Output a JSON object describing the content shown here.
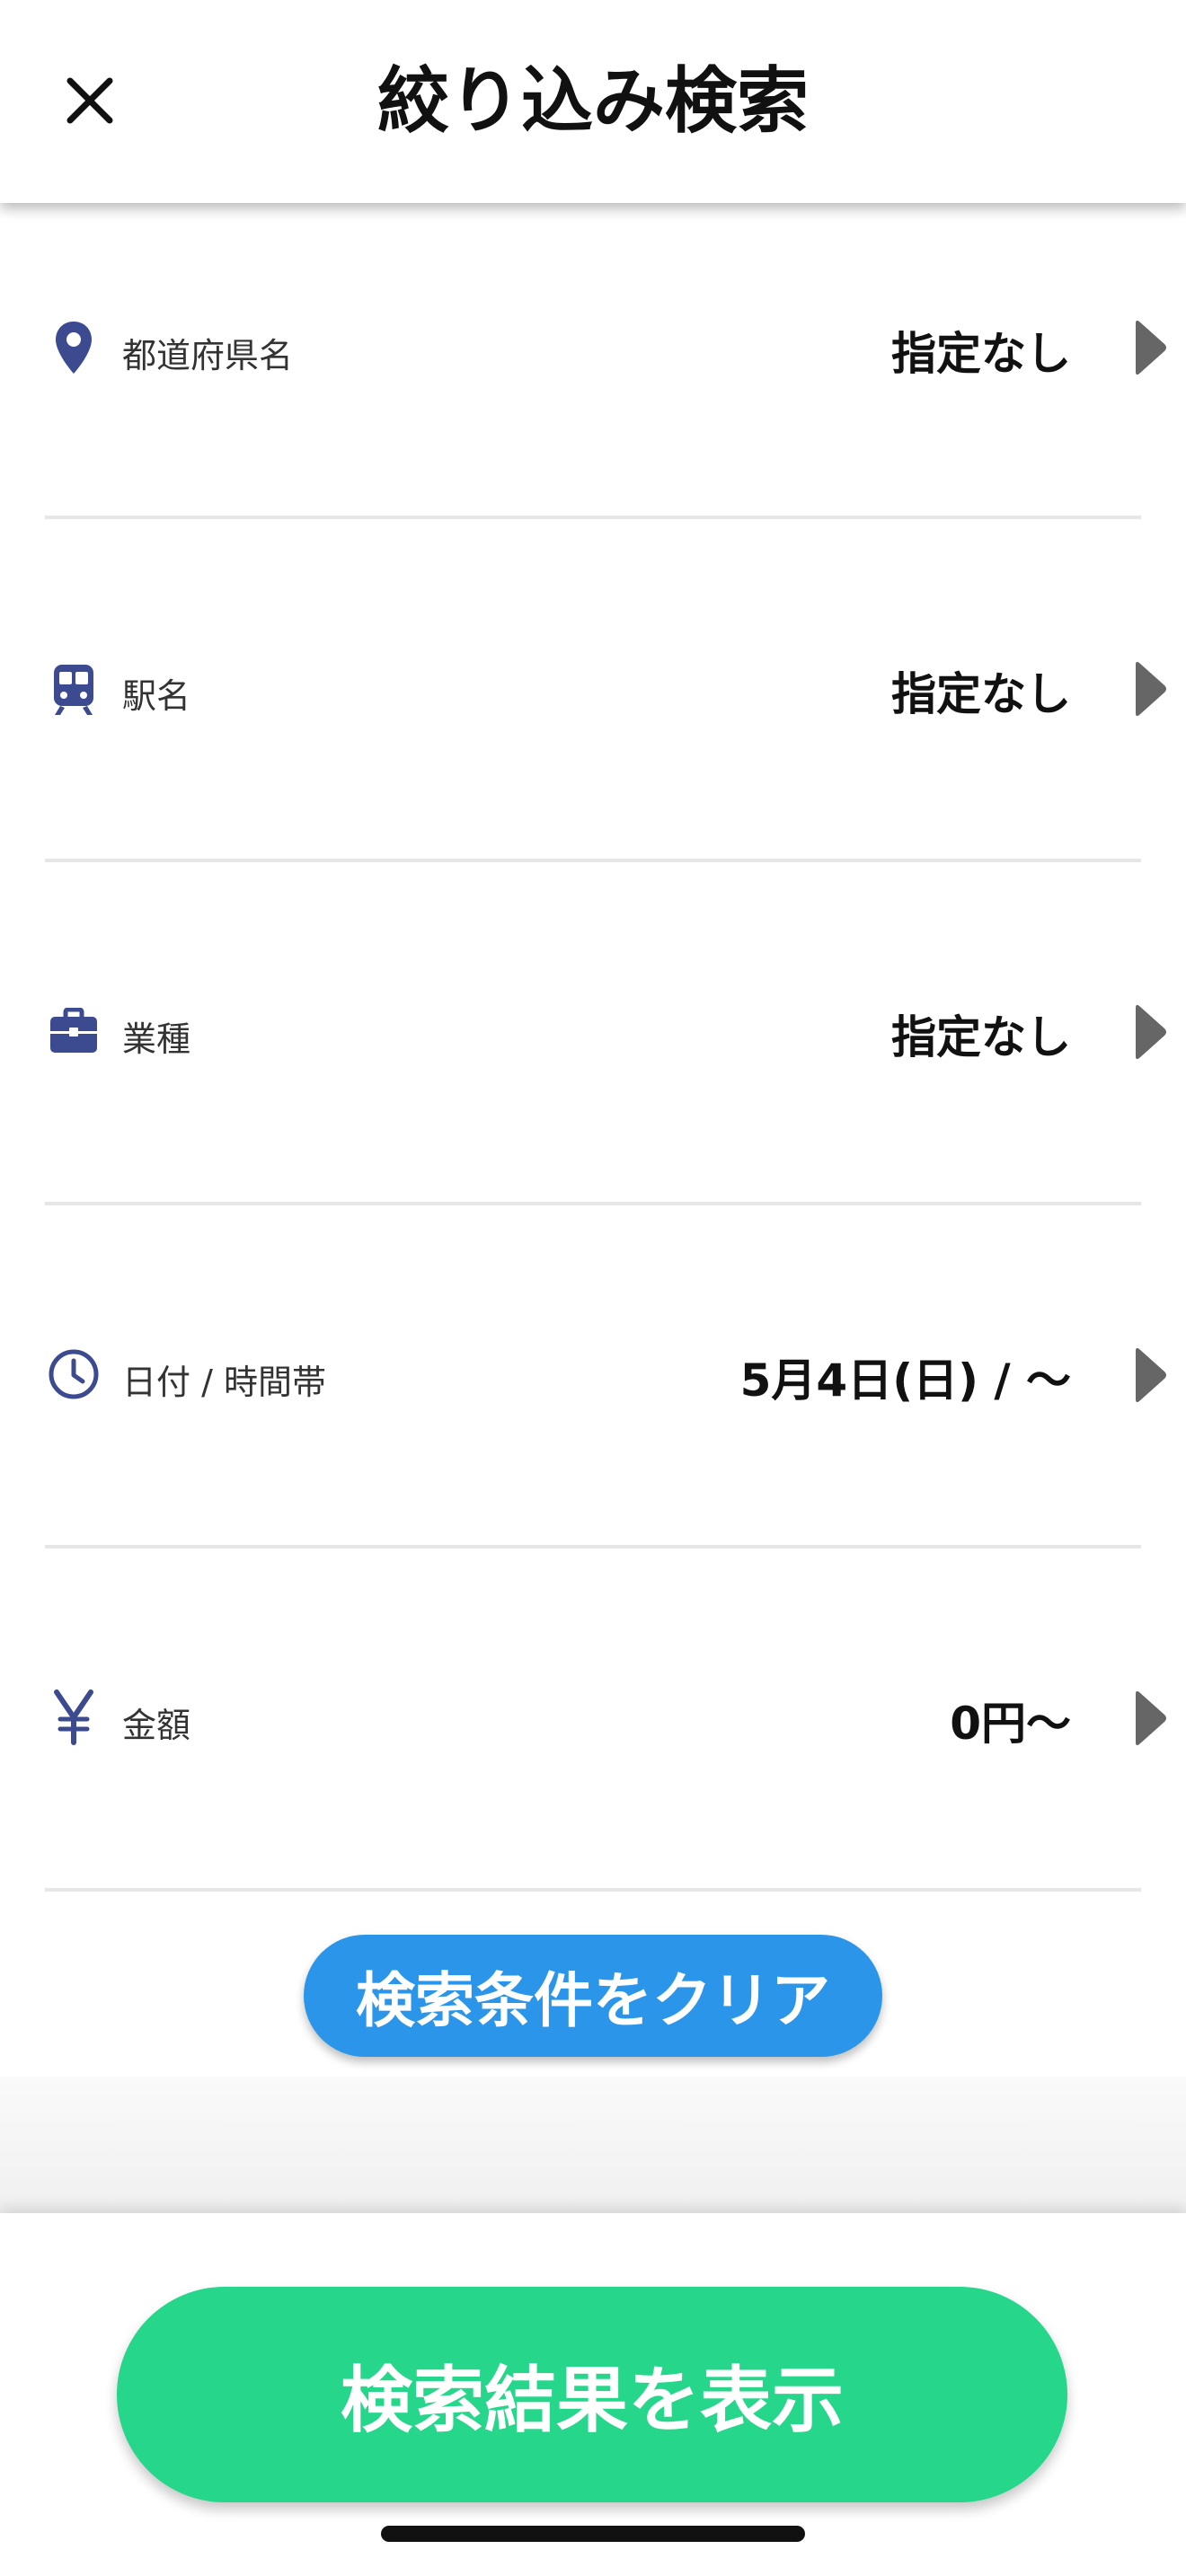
{
  "header": {
    "title": "絞り込み検索",
    "close_icon": "close-icon"
  },
  "rows": [
    {
      "icon": "location-pin-icon",
      "label": "都道府県名",
      "value": "指定なし"
    },
    {
      "icon": "train-icon",
      "label": "駅名",
      "value": "指定なし"
    },
    {
      "icon": "briefcase-icon",
      "label": "業種",
      "value": "指定なし"
    },
    {
      "icon": "clock-icon",
      "label": "日付 / 時間帯",
      "value": "5月4日(日) / 〜"
    },
    {
      "icon": "yen-icon",
      "label": "金額",
      "value": "0円〜"
    }
  ],
  "clear_button": {
    "label": "検索条件をクリア"
  },
  "show_results_button": {
    "label": "検索結果を表示"
  },
  "colors": {
    "icon": "#3c4a8f",
    "chevron": "#666666",
    "clear_button": "#2b95ea",
    "show_results_button": "#26d68a"
  }
}
